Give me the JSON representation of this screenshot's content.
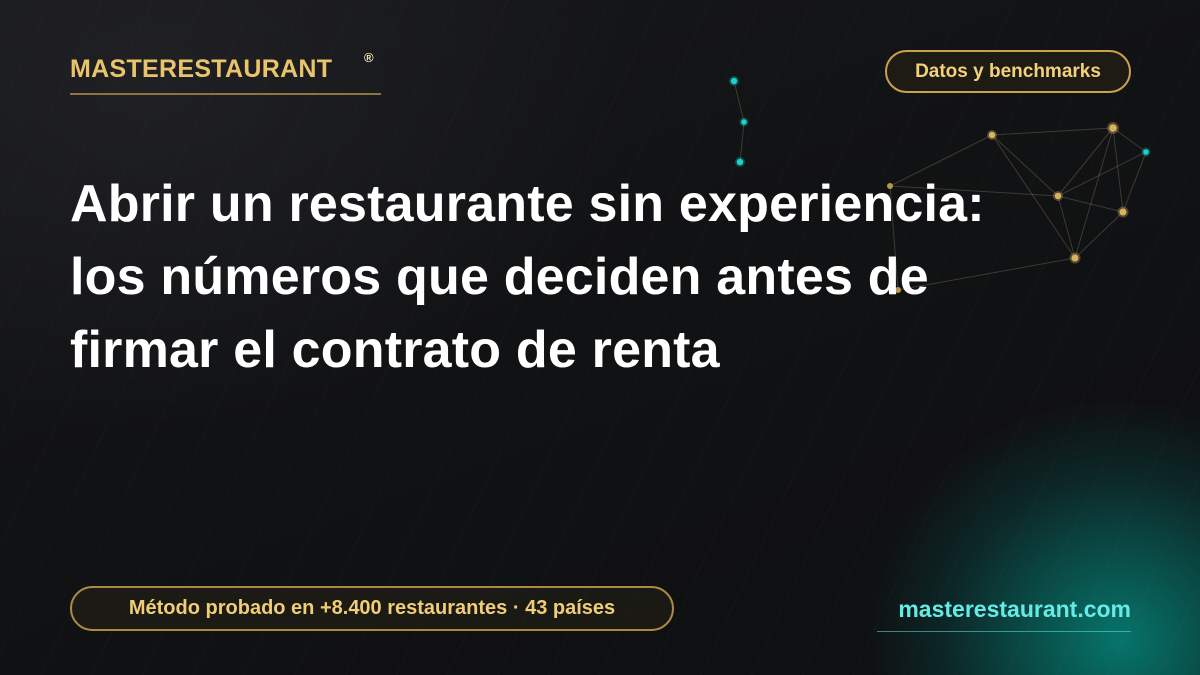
{
  "brand": {
    "name": "MASTERESTAURANT",
    "registered": "®"
  },
  "tag": "Datos y benchmarks",
  "headline": {
    "line1": "Abrir un restaurante sin experiencia:",
    "line2": "los números que deciden antes de",
    "line3": "firmar el contrato de renta"
  },
  "footer": {
    "proof": "Método probado en +8.400 restaurantes · 43 países",
    "website": "masterestaurant.com"
  },
  "colors": {
    "background": "#111214",
    "gold": "#e9c46a",
    "teal": "#64ebe6"
  },
  "decor": {
    "icon": "constellation-network-icon"
  }
}
